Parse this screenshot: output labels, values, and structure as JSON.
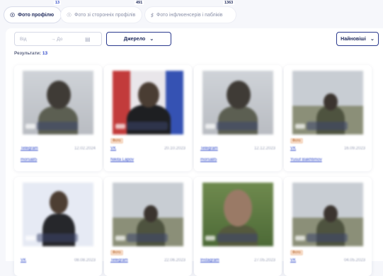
{
  "tabs": [
    {
      "label": "Фото профілю",
      "count": "13",
      "icon": "user-icon",
      "active": true
    },
    {
      "label": "Фото зі сторонніх профілів",
      "count": "491",
      "icon": "users-icon",
      "active": false
    },
    {
      "label": "Фото інфлюенсерів і пабліків",
      "count": "1363",
      "icon": "megaphone-icon",
      "active": false
    }
  ],
  "filters": {
    "date_from_placeholder": "Від",
    "date_to_placeholder": "→ До",
    "source_label": "Джерело",
    "sort_label": "Найновіші"
  },
  "results": {
    "label": "Результати:",
    "count": "13"
  },
  "cards": [
    {
      "source": "Telegram",
      "date": "12.02.2024",
      "account": "morsa85",
      "tag": ""
    },
    {
      "source": "VK",
      "date": "20.10.2023",
      "account": "Nikita Lapov",
      "tag": "Фото"
    },
    {
      "source": "Telegram",
      "date": "12.12.2023",
      "account": "morsa85",
      "tag": ""
    },
    {
      "source": "VK",
      "date": "16.09.2023",
      "account": "Yusuf Bakhtimov",
      "tag": "Фото"
    },
    {
      "source": "VK",
      "date": "08.08.2023",
      "account": "",
      "tag": ""
    },
    {
      "source": "Telegram",
      "date": "22.06.2023",
      "account": "",
      "tag": "Фото"
    },
    {
      "source": "Instagram",
      "date": "27.05.2023",
      "account": "",
      "tag": ""
    },
    {
      "source": "VK",
      "date": "04.05.2023",
      "account": "",
      "tag": "Фото"
    }
  ],
  "colors": {
    "accent": "#2f49c9",
    "tag_bg": "#f6d9c4",
    "text": "#1f2a5c"
  }
}
